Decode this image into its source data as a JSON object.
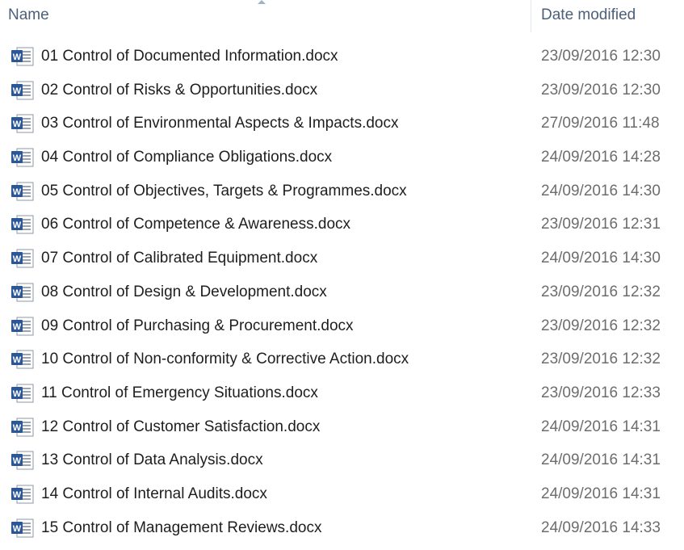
{
  "columns": {
    "name": "Name",
    "date_modified": "Date modified"
  },
  "files": [
    {
      "name": "01 Control of Documented Information.docx",
      "date": "23/09/2016 12:30",
      "icon": "word-document-icon"
    },
    {
      "name": "02 Control of Risks & Opportunities.docx",
      "date": "23/09/2016 12:30",
      "icon": "word-document-icon"
    },
    {
      "name": "03 Control of Environmental Aspects & Impacts.docx",
      "date": "27/09/2016 11:48",
      "icon": "word-document-icon"
    },
    {
      "name": "04 Control of Compliance Obligations.docx",
      "date": "24/09/2016 14:28",
      "icon": "word-document-icon"
    },
    {
      "name": "05 Control of Objectives, Targets & Programmes.docx",
      "date": "24/09/2016 14:30",
      "icon": "word-document-icon"
    },
    {
      "name": "06 Control of Competence & Awareness.docx",
      "date": "23/09/2016 12:31",
      "icon": "word-document-icon"
    },
    {
      "name": "07 Control of Calibrated Equipment.docx",
      "date": "24/09/2016 14:30",
      "icon": "word-document-icon"
    },
    {
      "name": "08 Control of Design & Development.docx",
      "date": "23/09/2016 12:32",
      "icon": "word-document-icon"
    },
    {
      "name": "09 Control of Purchasing & Procurement.docx",
      "date": "23/09/2016 12:32",
      "icon": "word-document-icon"
    },
    {
      "name": "10 Control of Non-conformity & Corrective Action.docx",
      "date": "23/09/2016 12:32",
      "icon": "word-document-icon"
    },
    {
      "name": "11 Control of Emergency Situations.docx",
      "date": "23/09/2016 12:33",
      "icon": "word-document-icon"
    },
    {
      "name": "12 Control of Customer Satisfaction.docx",
      "date": "24/09/2016 14:31",
      "icon": "word-document-icon"
    },
    {
      "name": "13 Control of Data Analysis.docx",
      "date": "24/09/2016 14:31",
      "icon": "word-document-icon"
    },
    {
      "name": "14 Control of Internal Audits.docx",
      "date": "24/09/2016 14:31",
      "icon": "word-document-icon"
    },
    {
      "name": "15 Control of Management Reviews.docx",
      "date": "24/09/2016 14:33",
      "icon": "word-document-icon"
    }
  ],
  "colors": {
    "header_text": "#4c607a",
    "name_text": "#1e1e1e",
    "date_text": "#6d6d6d",
    "word_blue": "#2b5797"
  }
}
